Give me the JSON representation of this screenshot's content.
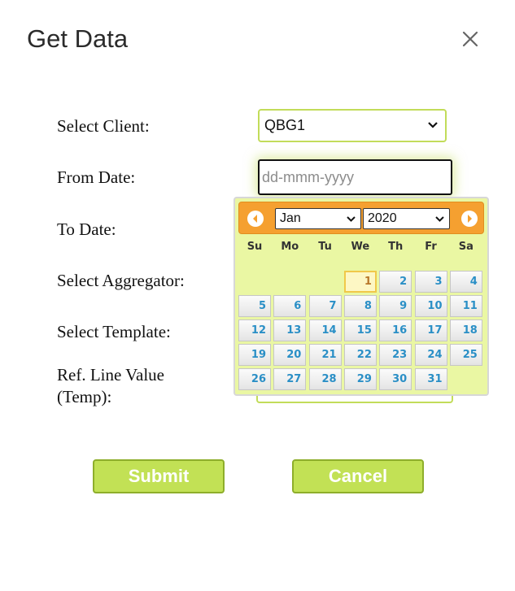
{
  "dialog": {
    "title": "Get Data"
  },
  "form": {
    "labels": {
      "client": "Select Client:",
      "from_date": "From Date:",
      "to_date": "To Date:",
      "aggregator": "Select Aggregator:",
      "template": "Select Template:",
      "ref_line_1": "Ref. Line Value",
      "ref_line_2": "(Temp):"
    },
    "client_value": "QBG1",
    "from_date_placeholder": "dd-mmm-yyyy"
  },
  "datepicker": {
    "month": "Jan",
    "year": "2020",
    "weekdays": [
      "Su",
      "Mo",
      "Tu",
      "We",
      "Th",
      "Fr",
      "Sa"
    ],
    "first_weekday_index": 3,
    "days_in_month": 31,
    "today": 1
  },
  "buttons": {
    "submit": "Submit",
    "cancel": "Cancel"
  },
  "colors": {
    "accent": "#c2e155",
    "header": "#f5a030",
    "calendar_bg": "#eaf7a3",
    "day_text": "#2a8fc6"
  }
}
